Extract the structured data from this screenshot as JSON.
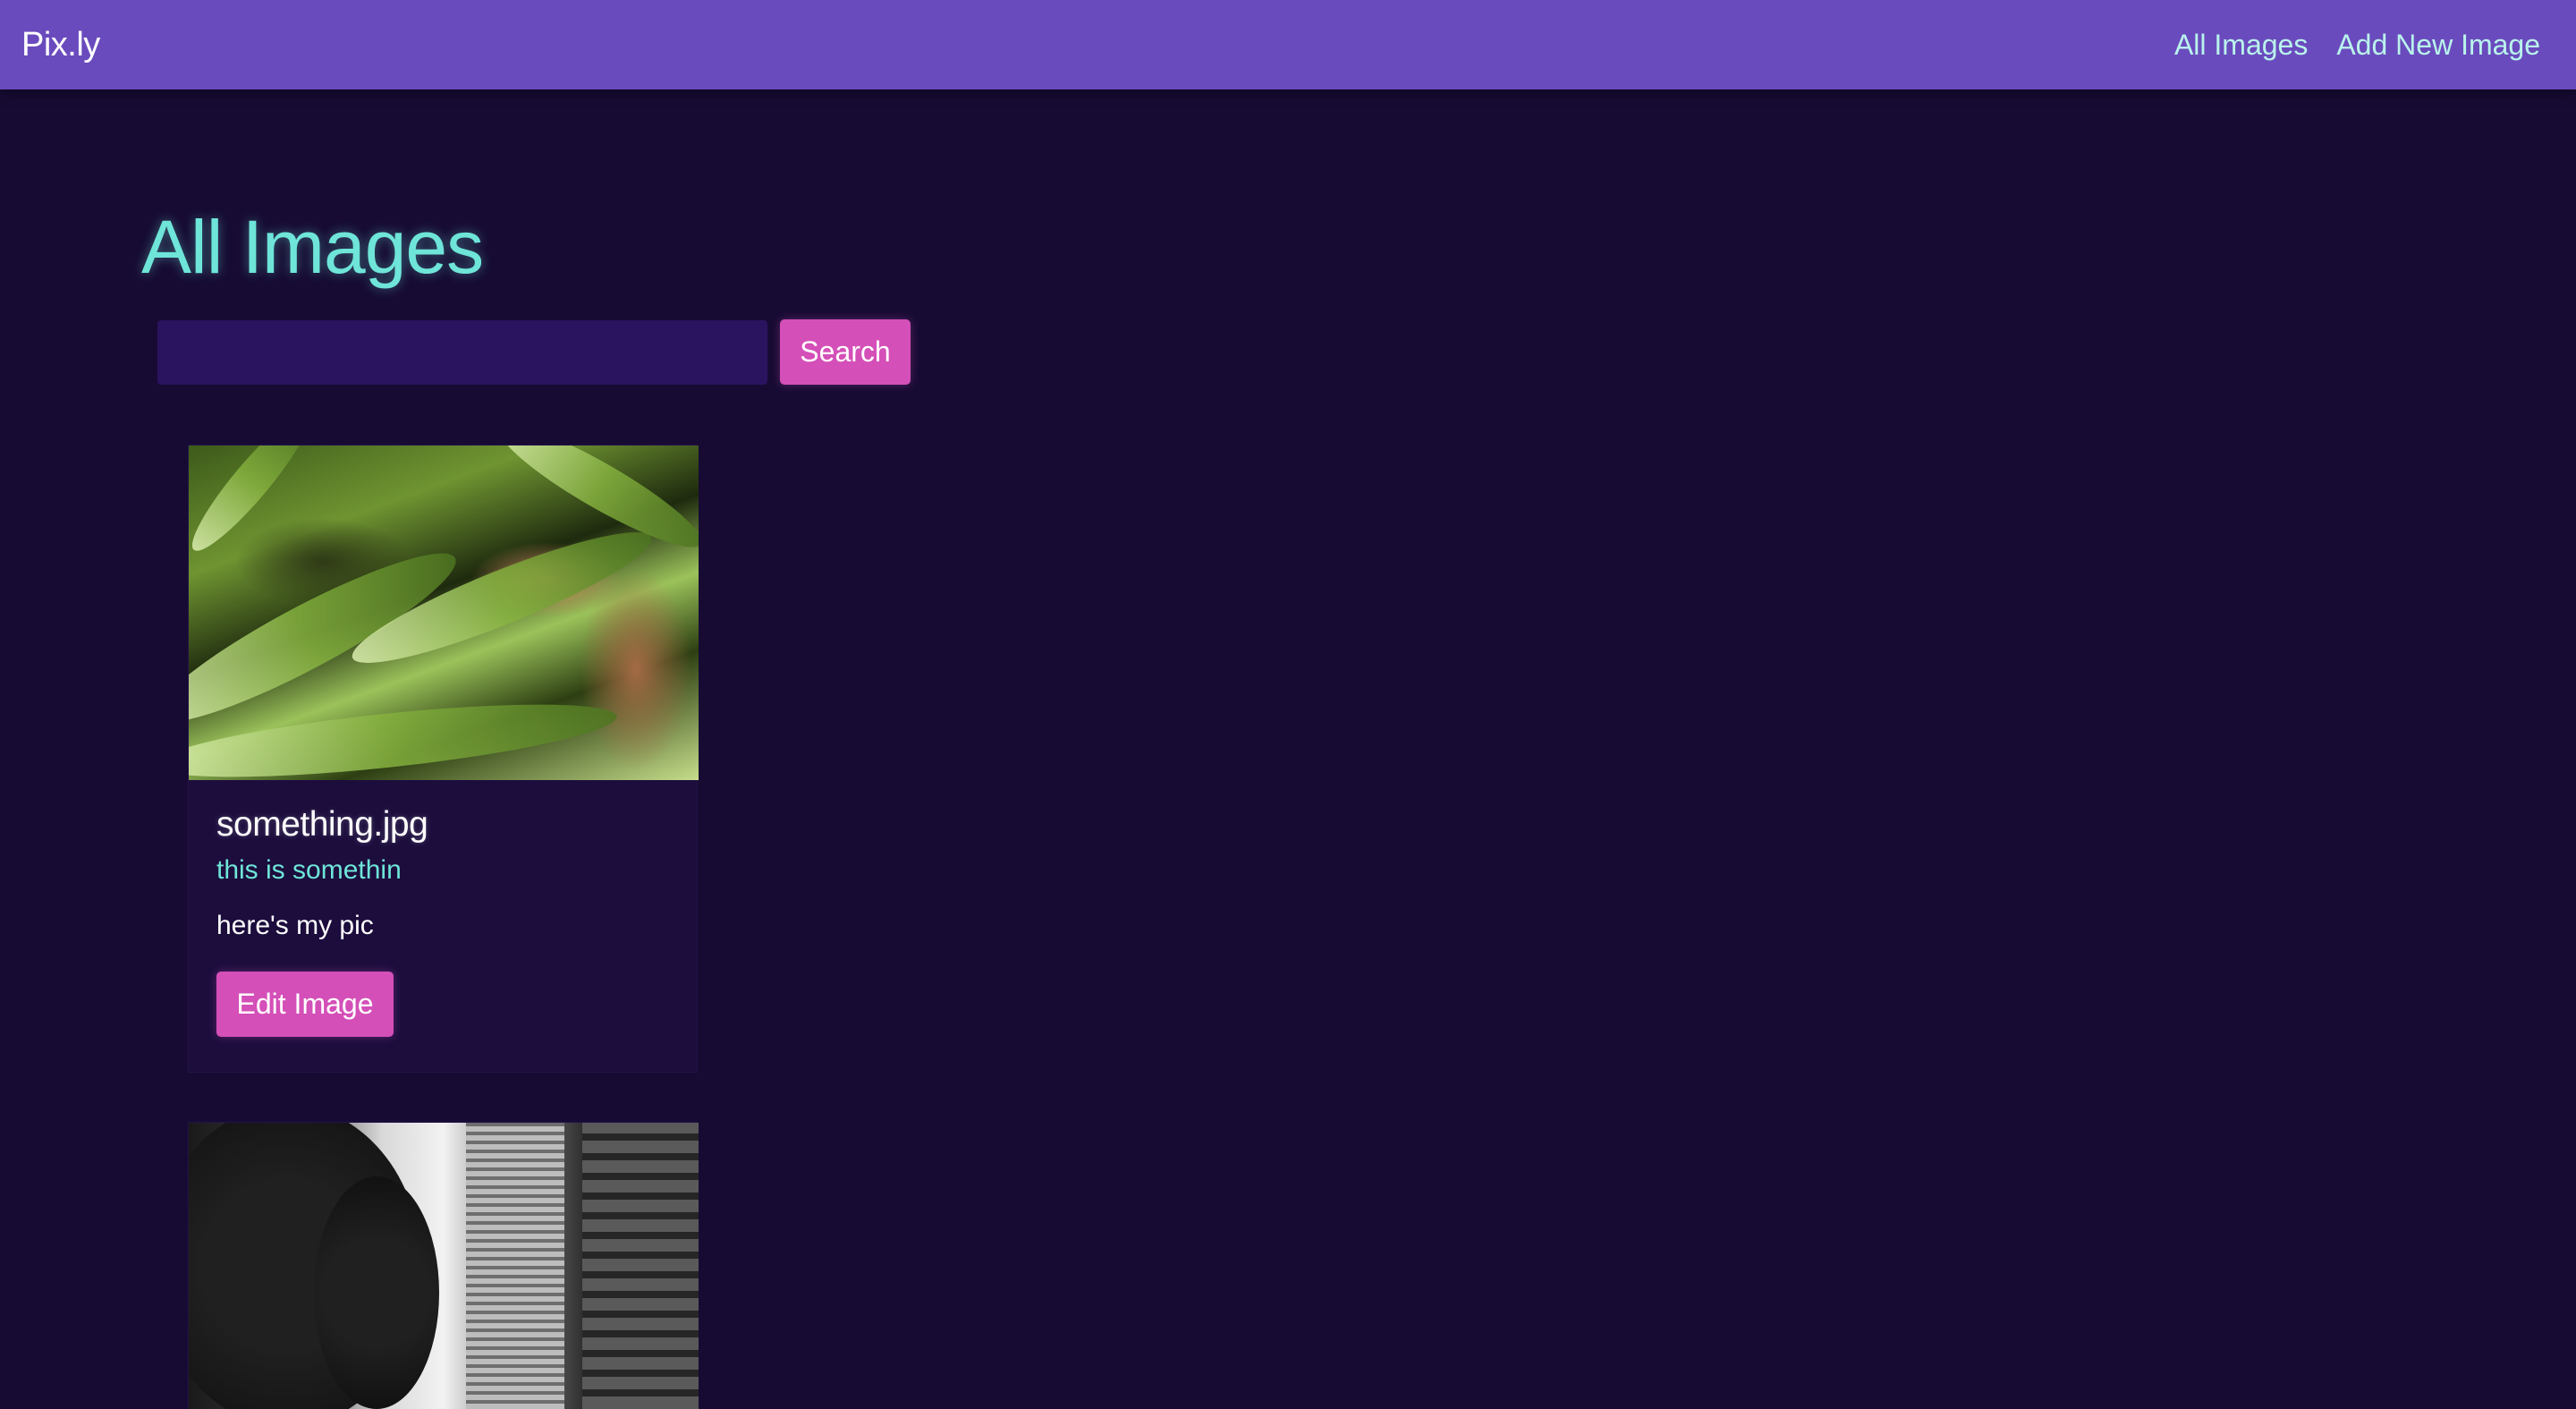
{
  "nav": {
    "brand": "Pix.ly",
    "links": [
      "All Images",
      "Add New Image"
    ]
  },
  "page": {
    "title": "All Images"
  },
  "search": {
    "value": "",
    "button_label": "Search"
  },
  "images": [
    {
      "title": "something.jpg",
      "subtitle": "this is somethin",
      "description": "here's my pic",
      "edit_label": "Edit Image"
    }
  ],
  "colors": {
    "navbar": "#6a4bbd",
    "background": "#170b33",
    "accent_teal": "#6ee5d8",
    "button_pink": "#d44fb8",
    "nav_link": "#b9f3ec"
  }
}
